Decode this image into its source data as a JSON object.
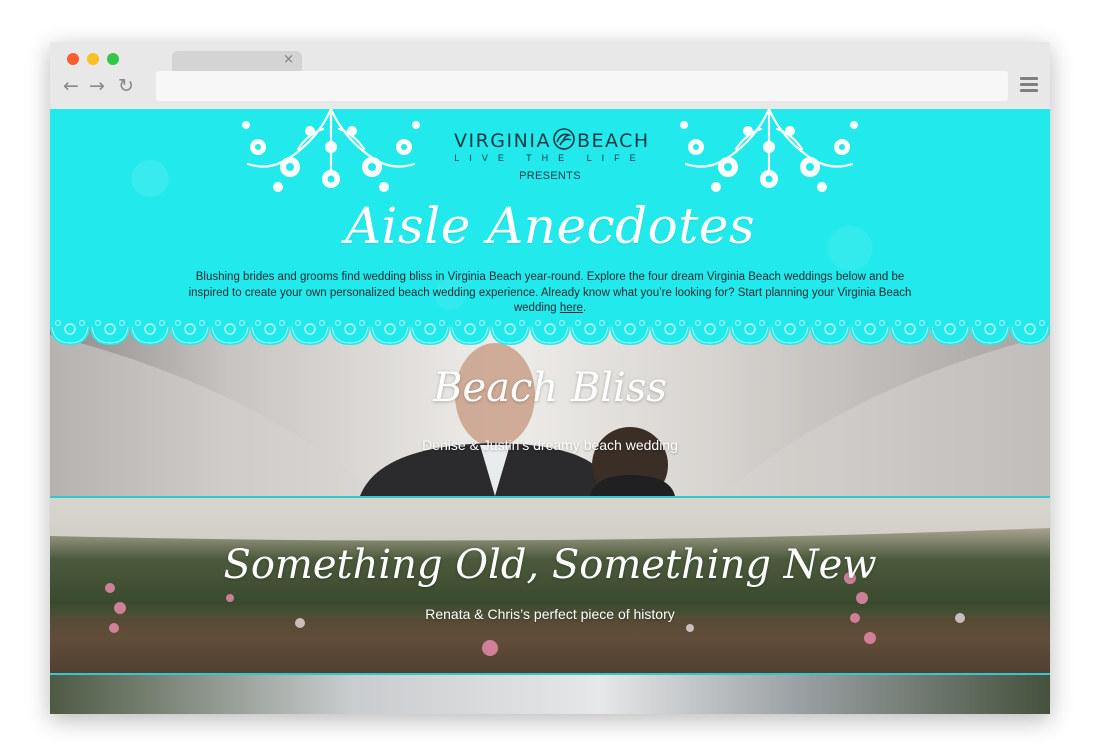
{
  "browser": {
    "tab_close": "×",
    "back_glyph": "←",
    "forward_glyph": "→",
    "reload_glyph": "↻",
    "address_value": ""
  },
  "header": {
    "logo_left": "VIRGINIA",
    "logo_right": "BEACH",
    "tagline": "LIVE THE LIFE",
    "presents": "PRESENTS",
    "title": "Aisle Anecdotes",
    "intro_text": "Blushing brides and grooms find wedding bliss in Virginia Beach year-round. Explore the four dream Virginia Beach weddings below and be inspired to create your own personalized beach wedding experience. Already know what you’re looking for? Start planning your Virginia Beach wedding ",
    "intro_link": "here",
    "intro_end": "."
  },
  "stories": [
    {
      "title": "Beach Bliss",
      "subtitle": "Denise & Justin’s dreamy beach wedding"
    },
    {
      "title": "Something Old, Something New",
      "subtitle": "Renata & Chris’s perfect piece of history"
    }
  ],
  "colors": {
    "accent": "#22e9ec",
    "divider": "#2fc9cf",
    "dark_text": "#163a44"
  }
}
